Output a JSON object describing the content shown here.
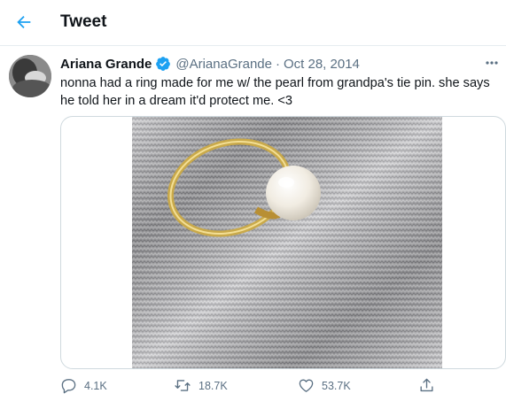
{
  "header": {
    "title": "Tweet",
    "back_icon": "arrow-left-icon"
  },
  "tweet": {
    "author": {
      "name": "Ariana Grande",
      "handle": "@ArianaGrande",
      "verified": true,
      "verified_icon": "verified-badge-icon"
    },
    "separator": "·",
    "date": "Oct 28, 2014",
    "text": "nonna had a ring made for me w/ the pearl from grandpa's tie pin. she says he told her in a dream it'd protect me. <3",
    "media": {
      "icon": "photo-pearl-ring"
    },
    "stats": {
      "replies": "4.1K",
      "retweets": "18.7K",
      "likes": "53.7K"
    }
  },
  "colors": {
    "accent": "#1da1f2",
    "text_primary": "#0f1419",
    "text_secondary": "#5b7083",
    "border": "#cfd9de"
  }
}
